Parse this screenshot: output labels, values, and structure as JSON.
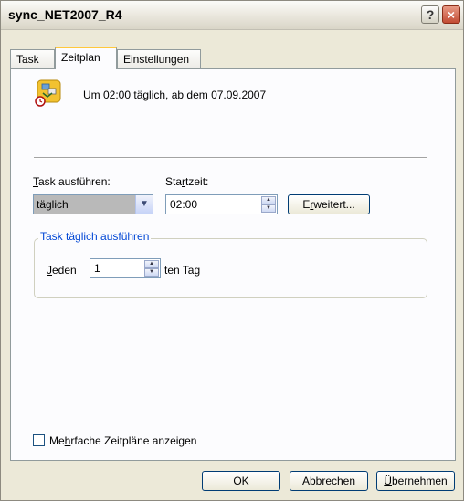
{
  "window": {
    "title": "sync_NET2007_R4",
    "help_glyph": "?",
    "close_glyph": "×"
  },
  "tabs": [
    {
      "label": "Task",
      "active": false
    },
    {
      "label": "Zeitplan",
      "active": true
    },
    {
      "label": "Einstellungen",
      "active": false
    }
  ],
  "schedule": {
    "summary": "Um 02:00 täglich, ab dem 07.09.2007",
    "run_task_label_mnemonic": "T",
    "run_task_label_rest": "ask ausführen:",
    "run_task_value": "täglich",
    "start_time_label_pre": "Sta",
    "start_time_label_mnemonic": "r",
    "start_time_label_post": "tzeit:",
    "start_time_value": "02:00",
    "advanced_pre": "E",
    "advanced_mnemonic": "r",
    "advanced_post": "weitert...",
    "daily_group_title": "Task täglich ausführen",
    "every_mnemonic": "J",
    "every_rest": "eden",
    "every_value": "1",
    "every_suffix": "ten Tag"
  },
  "multi_schedules": {
    "pre": "Me",
    "mnemonic": "h",
    "post": "rfache Zeitpläne anzeigen",
    "checked": false
  },
  "footer": {
    "ok_label": "OK",
    "cancel_label": "Abbrechen",
    "apply_mnemonic": "Ü",
    "apply_rest": "bernehmen"
  },
  "icons": {
    "task_icon": "scheduled-task-icon",
    "dropdown": "chevron-down-icon",
    "spin_up": "spin-up-icon",
    "spin_down": "spin-down-icon"
  },
  "colors": {
    "group_title": "#0046d5",
    "active_tab_accent": "#ffc83c",
    "dropdown_selection": "#b9b9b9"
  }
}
